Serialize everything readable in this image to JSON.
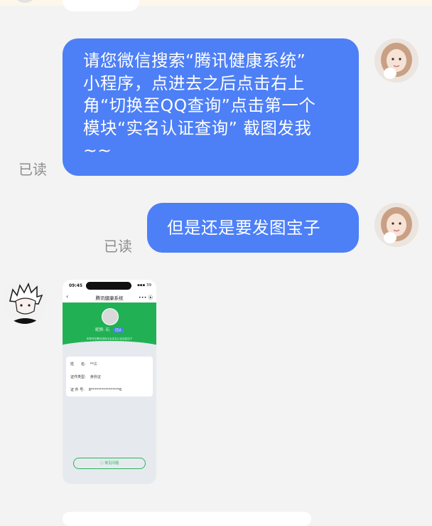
{
  "messages": [
    {
      "sender": "me",
      "text": "请您微信搜索“腾讯健康系统”\n小程序，点进去之后点击右上\n角“切换至QQ查询”点击第一个\n模块“实名认证查询” 截图发我\n~~",
      "status": "已读"
    },
    {
      "sender": "me",
      "text": "但是还是要发图宝子",
      "status": "已读"
    }
  ],
  "image_message": {
    "time": "09:45",
    "signal": "▪▪▪ 39",
    "app_title": "腾讯健康系统",
    "back_icon": "chevron-left-icon",
    "title_actions": "••• ⦿",
    "nickname_label": "昵称:",
    "nickname_value": "石",
    "badge": "已认",
    "subtitle": "本账号在腾讯游戏平台实名认证信息如下",
    "fields": [
      {
        "label": "姓　　名:",
        "value": "**江"
      },
      {
        "label": "证件类型:",
        "value": "身份证"
      },
      {
        "label": "证 件 号:",
        "value": "8****************6"
      }
    ],
    "faq_button": "ⓘ 常见问题"
  },
  "colors": {
    "bubble_out": "#4d7ff6",
    "background": "#f3f3f3",
    "read_text": "#8d8d8d",
    "green_header": "#21b154"
  },
  "icons": {
    "my_avatar": "girl-avatar-icon",
    "other_avatar": "anime-boy-avatar-icon"
  }
}
